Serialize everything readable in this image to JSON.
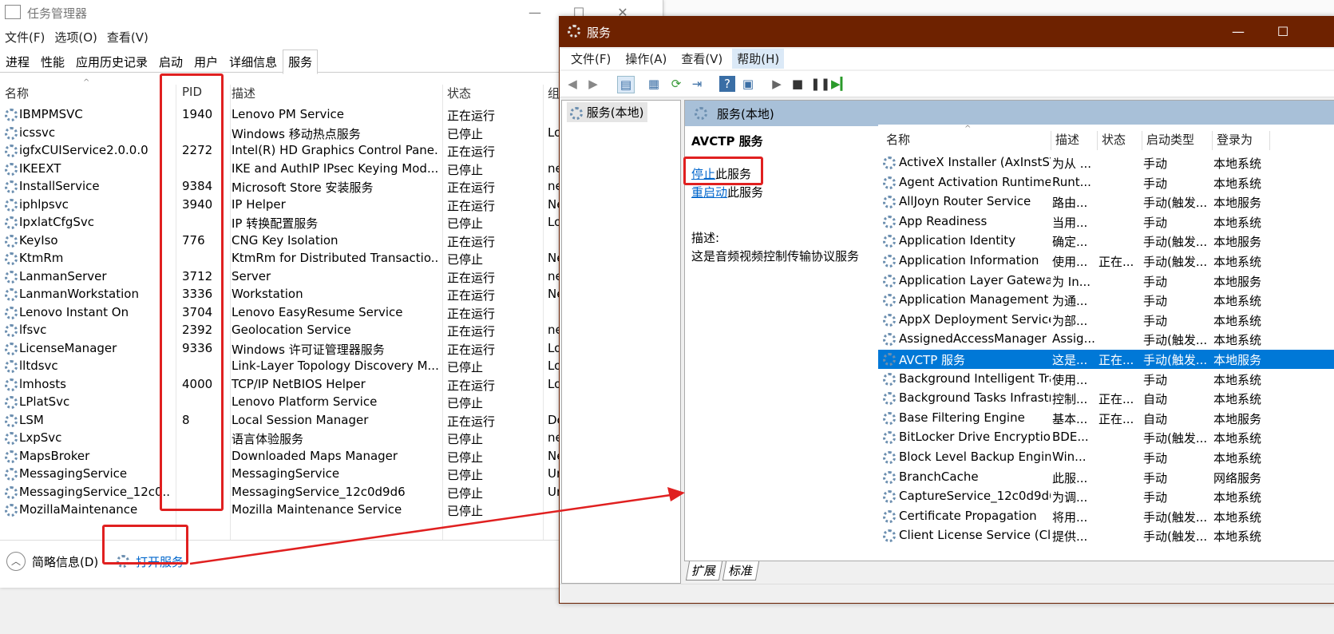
{
  "task_manager": {
    "title": "任务管理器",
    "menu": [
      "文件(F)",
      "选项(O)",
      "查看(V)"
    ],
    "tabs": [
      "进程",
      "性能",
      "应用历史记录",
      "启动",
      "用户",
      "详细信息",
      "服务"
    ],
    "active_tab": "服务",
    "columns": {
      "name": "名称",
      "pid": "PID",
      "desc": "描述",
      "status": "状态",
      "group": "组"
    },
    "rows": [
      {
        "name": "IBMPMSVC",
        "pid": "1940",
        "desc": "Lenovo PM Service",
        "status": "正在运行",
        "group": ""
      },
      {
        "name": "icssvc",
        "pid": "",
        "desc": "Windows 移动热点服务",
        "status": "已停止",
        "group": "Lo"
      },
      {
        "name": "igfxCUIService2.0.0.0",
        "pid": "2272",
        "desc": "Intel(R) HD Graphics Control Pane...",
        "status": "正在运行",
        "group": ""
      },
      {
        "name": "IKEEXT",
        "pid": "",
        "desc": "IKE and AuthIP IPsec Keying Mod...",
        "status": "已停止",
        "group": "ne"
      },
      {
        "name": "InstallService",
        "pid": "9384",
        "desc": "Microsoft Store 安装服务",
        "status": "正在运行",
        "group": "ne"
      },
      {
        "name": "iphlpsvc",
        "pid": "3940",
        "desc": "IP Helper",
        "status": "正在运行",
        "group": "Ne"
      },
      {
        "name": "IpxlatCfgSvc",
        "pid": "",
        "desc": "IP 转换配置服务",
        "status": "已停止",
        "group": "Lo"
      },
      {
        "name": "KeyIso",
        "pid": "776",
        "desc": "CNG Key Isolation",
        "status": "正在运行",
        "group": ""
      },
      {
        "name": "KtmRm",
        "pid": "",
        "desc": "KtmRm for Distributed Transactio...",
        "status": "已停止",
        "group": "Ne"
      },
      {
        "name": "LanmanServer",
        "pid": "3712",
        "desc": "Server",
        "status": "正在运行",
        "group": "ne"
      },
      {
        "name": "LanmanWorkstation",
        "pid": "3336",
        "desc": "Workstation",
        "status": "正在运行",
        "group": "Ne"
      },
      {
        "name": "Lenovo Instant On",
        "pid": "3704",
        "desc": "Lenovo EasyResume Service",
        "status": "正在运行",
        "group": ""
      },
      {
        "name": "lfsvc",
        "pid": "2392",
        "desc": "Geolocation Service",
        "status": "正在运行",
        "group": "ne"
      },
      {
        "name": "LicenseManager",
        "pid": "9336",
        "desc": "Windows 许可证管理器服务",
        "status": "正在运行",
        "group": "Lo"
      },
      {
        "name": "lltdsvc",
        "pid": "",
        "desc": "Link-Layer Topology Discovery M...",
        "status": "已停止",
        "group": "Lo"
      },
      {
        "name": "lmhosts",
        "pid": "4000",
        "desc": "TCP/IP NetBIOS Helper",
        "status": "正在运行",
        "group": "Lo"
      },
      {
        "name": "LPlatSvc",
        "pid": "",
        "desc": "Lenovo Platform Service",
        "status": "已停止",
        "group": ""
      },
      {
        "name": "LSM",
        "pid": "8",
        "desc": "Local Session Manager",
        "status": "正在运行",
        "group": "Dc"
      },
      {
        "name": "LxpSvc",
        "pid": "",
        "desc": "语言体验服务",
        "status": "已停止",
        "group": "ne"
      },
      {
        "name": "MapsBroker",
        "pid": "",
        "desc": "Downloaded Maps Manager",
        "status": "已停止",
        "group": "Ne"
      },
      {
        "name": "MessagingService",
        "pid": "",
        "desc": "MessagingService",
        "status": "已停止",
        "group": "Ur"
      },
      {
        "name": "MessagingService_12c0...",
        "pid": "",
        "desc": "MessagingService_12c0d9d6",
        "status": "已停止",
        "group": "Ur"
      },
      {
        "name": "MozillaMaintenance",
        "pid": "",
        "desc": "Mozilla Maintenance Service",
        "status": "已停止",
        "group": ""
      }
    ],
    "footer": {
      "brief": "简略信息(D)",
      "open_services": "打开服务"
    }
  },
  "services": {
    "title": "服务",
    "menu": [
      "文件(F)",
      "操作(A)",
      "查看(V)",
      "帮助(H)"
    ],
    "tree_node": "服务(本地)",
    "header": "服务(本地)",
    "detail": {
      "service_name": "AVCTP 服务",
      "stop_link": "停止",
      "stop_suffix": "此服务",
      "restart_link": "重启动",
      "restart_suffix": "此服务",
      "desc_label": "描述:",
      "desc_text": "这是音频视频控制传输协议服务"
    },
    "columns": {
      "name": "名称",
      "desc": "描述",
      "status": "状态",
      "startup": "启动类型",
      "logon": "登录为"
    },
    "rows": [
      {
        "name": "ActiveX Installer (AxInstSV)",
        "desc": "为从 ...",
        "status": "",
        "startup": "手动",
        "logon": "本地系统"
      },
      {
        "name": "Agent Activation Runtime_...",
        "desc": "Runt...",
        "status": "",
        "startup": "手动",
        "logon": "本地系统"
      },
      {
        "name": "AllJoyn Router Service",
        "desc": "路由...",
        "status": "",
        "startup": "手动(触发...",
        "logon": "本地服务"
      },
      {
        "name": "App Readiness",
        "desc": "当用...",
        "status": "",
        "startup": "手动",
        "logon": "本地系统"
      },
      {
        "name": "Application Identity",
        "desc": "确定...",
        "status": "",
        "startup": "手动(触发...",
        "logon": "本地服务"
      },
      {
        "name": "Application Information",
        "desc": "使用...",
        "status": "正在...",
        "startup": "手动(触发...",
        "logon": "本地系统"
      },
      {
        "name": "Application Layer Gateway ...",
        "desc": "为 In...",
        "status": "",
        "startup": "手动",
        "logon": "本地服务"
      },
      {
        "name": "Application Management",
        "desc": "为通...",
        "status": "",
        "startup": "手动",
        "logon": "本地系统"
      },
      {
        "name": "AppX Deployment Service ...",
        "desc": "为部...",
        "status": "",
        "startup": "手动",
        "logon": "本地系统"
      },
      {
        "name": "AssignedAccessManager ...",
        "desc": "Assig...",
        "status": "",
        "startup": "手动(触发...",
        "logon": "本地系统"
      },
      {
        "name": "AVCTP 服务",
        "desc": "这是...",
        "status": "正在...",
        "startup": "手动(触发...",
        "logon": "本地服务"
      },
      {
        "name": "Background Intelligent Tra...",
        "desc": "使用...",
        "status": "",
        "startup": "手动",
        "logon": "本地系统"
      },
      {
        "name": "Background Tasks Infrastru...",
        "desc": "控制...",
        "status": "正在...",
        "startup": "自动",
        "logon": "本地系统"
      },
      {
        "name": "Base Filtering Engine",
        "desc": "基本...",
        "status": "正在...",
        "startup": "自动",
        "logon": "本地服务"
      },
      {
        "name": "BitLocker Drive Encryption ...",
        "desc": "BDE...",
        "status": "",
        "startup": "手动(触发...",
        "logon": "本地系统"
      },
      {
        "name": "Block Level Backup Engine ...",
        "desc": "Win...",
        "status": "",
        "startup": "手动",
        "logon": "本地系统"
      },
      {
        "name": "BranchCache",
        "desc": "此服...",
        "status": "",
        "startup": "手动",
        "logon": "网络服务"
      },
      {
        "name": "CaptureService_12c0d9d6",
        "desc": "为调...",
        "status": "",
        "startup": "手动",
        "logon": "本地系统"
      },
      {
        "name": "Certificate Propagation",
        "desc": "将用...",
        "status": "",
        "startup": "手动(触发...",
        "logon": "本地系统"
      },
      {
        "name": "Client License Service (Clip...",
        "desc": "提供...",
        "status": "",
        "startup": "手动(触发...",
        "logon": "本地系统"
      }
    ],
    "selected_index": 10,
    "bottom_tabs": [
      "扩展",
      "标准"
    ]
  },
  "colors": {
    "services_title": "#6e2200",
    "selection": "#0078d7",
    "annotation": "#e02020",
    "link": "#0066cc"
  }
}
